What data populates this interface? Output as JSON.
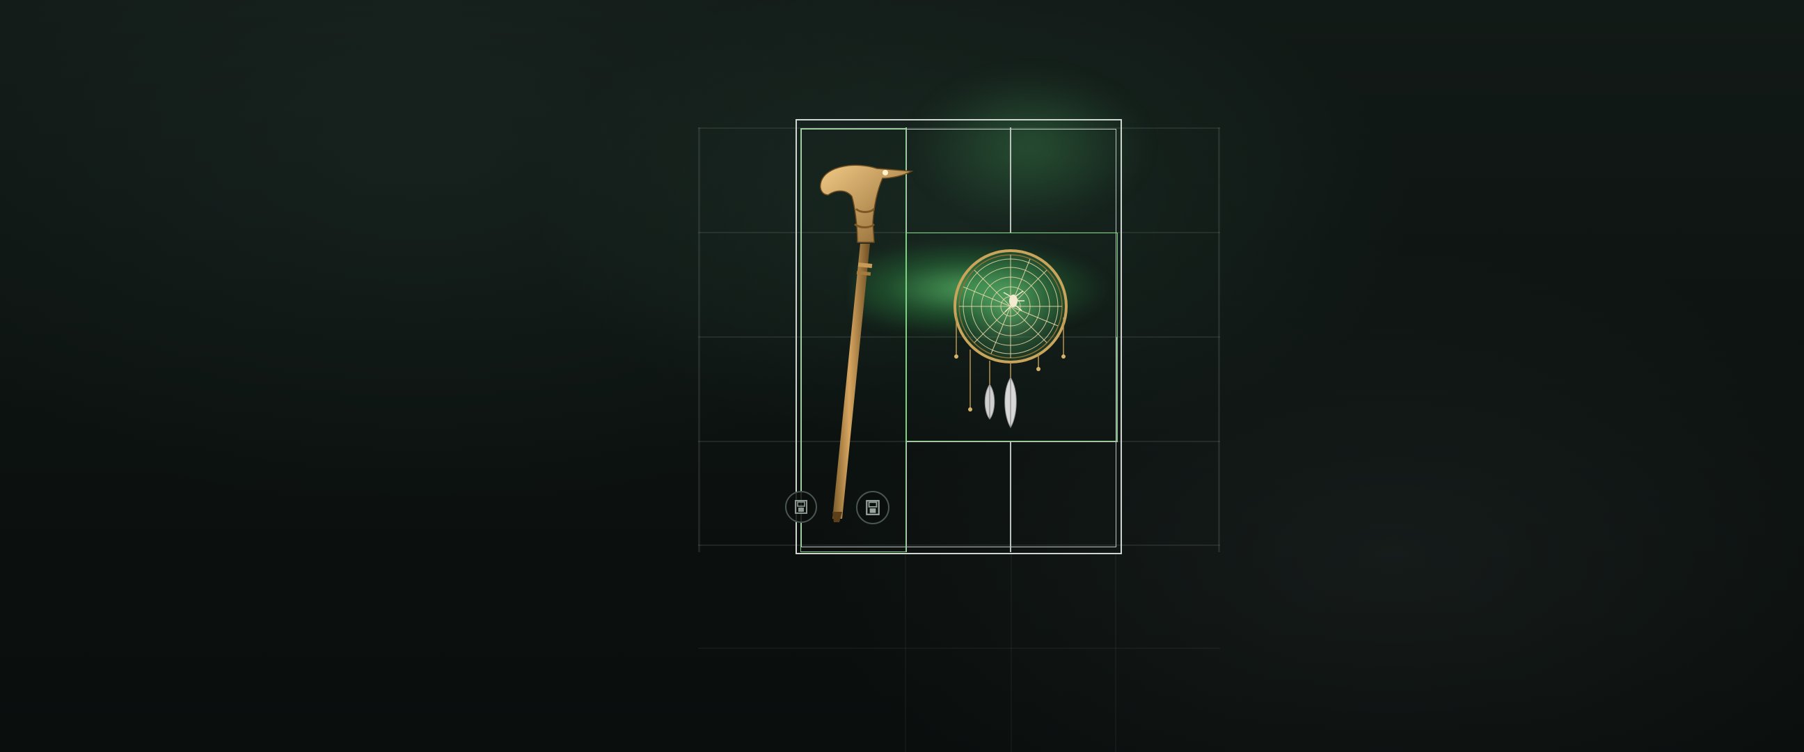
{
  "scene": {
    "background_color": "#0b100e",
    "accent_color": "#7fd27f",
    "grid_line_color": "#b9c2be"
  },
  "inventory": {
    "columns": 3,
    "rows": 4,
    "items": [
      {
        "name": "golden-cane",
        "icon": "cane-icon",
        "span_columns": 1,
        "span_rows": 4,
        "status_icon": "save-lock-icon"
      },
      {
        "name": "dreamcatcher",
        "icon": "dreamcatcher-icon",
        "span_columns": 2,
        "span_rows": 2
      }
    ],
    "empty_slot_icon": "save-lock-icon"
  }
}
